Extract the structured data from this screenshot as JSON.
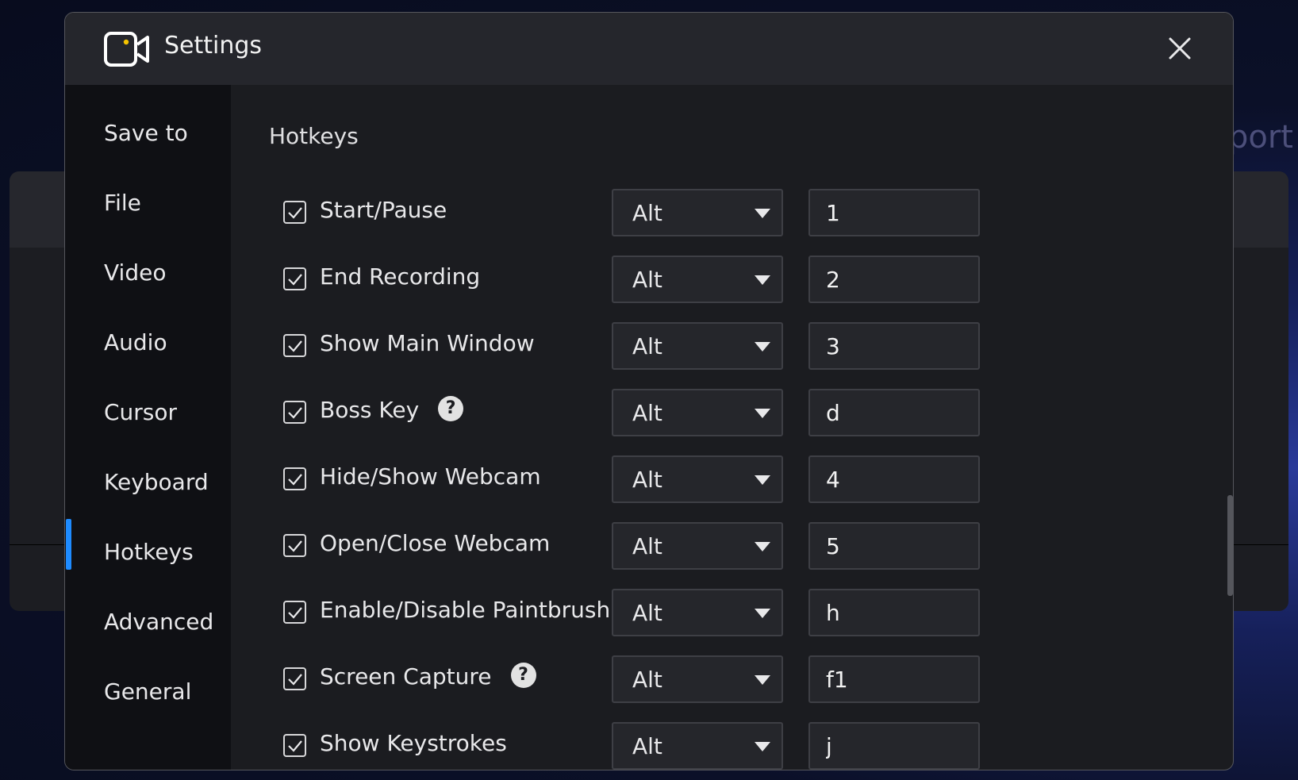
{
  "background": {
    "partial_text": "port"
  },
  "dialog": {
    "title": "Settings",
    "accent_color": "#1e8bff",
    "icon_dot_color": "#f5c400"
  },
  "sidebar": {
    "items": [
      {
        "label": "Save to"
      },
      {
        "label": "File"
      },
      {
        "label": "Video"
      },
      {
        "label": "Audio"
      },
      {
        "label": "Cursor"
      },
      {
        "label": "Keyboard"
      },
      {
        "label": "Hotkeys",
        "active": true
      },
      {
        "label": "Advanced"
      },
      {
        "label": "General"
      }
    ]
  },
  "hotkeys": {
    "heading": "Hotkeys",
    "rows": [
      {
        "label": "Start/Pause",
        "checked": true,
        "modifier": "Alt",
        "key": "1",
        "help": false
      },
      {
        "label": "End Recording",
        "checked": true,
        "modifier": "Alt",
        "key": "2",
        "help": false
      },
      {
        "label": "Show Main Window",
        "checked": true,
        "modifier": "Alt",
        "key": "3",
        "help": false
      },
      {
        "label": "Boss Key",
        "checked": true,
        "modifier": "Alt",
        "key": "d",
        "help": true
      },
      {
        "label": "Hide/Show Webcam",
        "checked": true,
        "modifier": "Alt",
        "key": "4",
        "help": false
      },
      {
        "label": "Open/Close Webcam",
        "checked": true,
        "modifier": "Alt",
        "key": "5",
        "help": false
      },
      {
        "label": "Enable/Disable Paintbrush",
        "checked": true,
        "modifier": "Alt",
        "key": "h",
        "help": false
      },
      {
        "label": "Screen Capture",
        "checked": true,
        "modifier": "Alt",
        "key": "f1",
        "help": true
      },
      {
        "label": "Show Keystrokes",
        "checked": true,
        "modifier": "Alt",
        "key": "j",
        "help": false
      }
    ]
  }
}
